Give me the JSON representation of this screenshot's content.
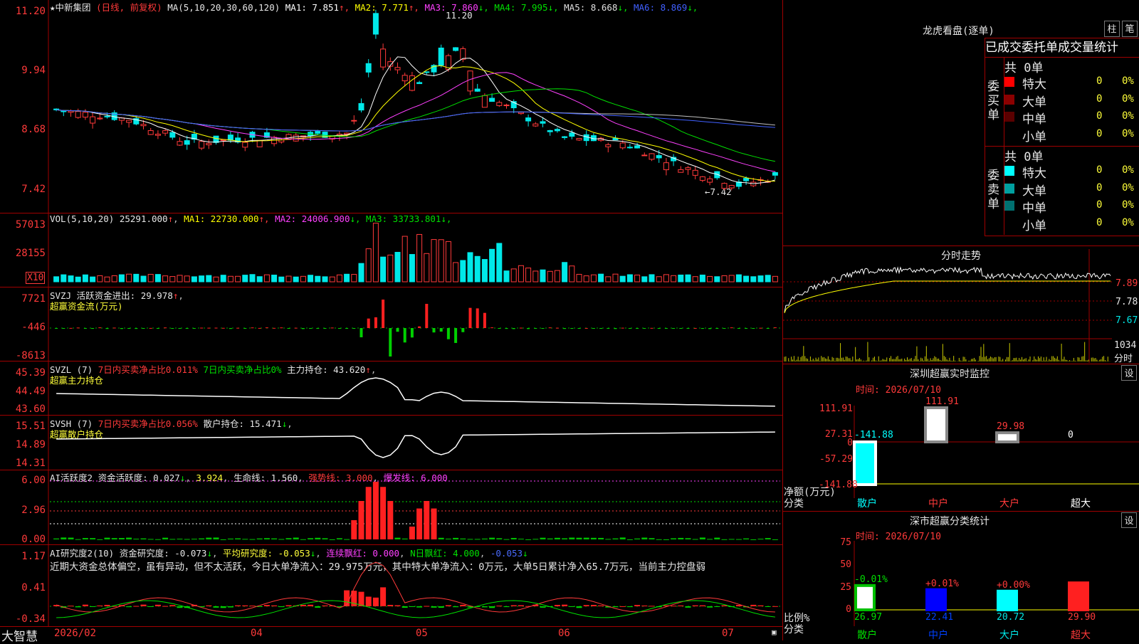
{
  "stock": {
    "name": "★中新集团",
    "mode": "(日线, 前复权)",
    "ma_header": "MA(5,10,20,30,60,120)",
    "ma": [
      {
        "label": "MA1: 7.851",
        "arrow": "↑",
        "color": "#ffffff"
      },
      {
        "label": "MA2: 7.771",
        "arrow": "↑",
        "color": "#ffff00"
      },
      {
        "label": "MA3: 7.860",
        "arrow": "↓",
        "color": "#ff40ff"
      },
      {
        "label": "MA4: 7.995",
        "arrow": "↓",
        "color": "#00e000"
      },
      {
        "label": "MA5: 8.668",
        "arrow": "↓",
        "color": "#e0e0e0"
      },
      {
        "label": "MA6: 8.869",
        "arrow": "↓",
        "color": "#4060ff"
      }
    ],
    "high_mark": "11.20",
    "low_mark": "←7.42",
    "price_axis": [
      "11.20",
      "9.94",
      "8.68",
      "7.42"
    ]
  },
  "volume": {
    "header": "VOL(5,10,20)",
    "value": "25291.000",
    "ma": [
      {
        "label": "MA1: 22730.000",
        "arrow": "↑",
        "color": "#ffff00"
      },
      {
        "label": "MA2: 24006.900",
        "arrow": "↓",
        "color": "#ff40ff"
      },
      {
        "label": "MA3: 33733.801",
        "arrow": "↓",
        "color": "#00e000"
      }
    ],
    "axis": [
      "57013",
      "28155"
    ],
    "unit": "X10"
  },
  "svzj": {
    "header": "SVZJ",
    "label": "活跃资金进出: 29.978",
    "arrow": "↑",
    "title": "超赢资金流(万元)",
    "axis": [
      "7721",
      "-446",
      "-8613"
    ]
  },
  "svzl": {
    "header": "SVZL (7)",
    "t1": "7日内买卖净占比0.011%",
    "t2": "7日内买卖净占比0%",
    "t3": "主力持仓: 43.620",
    "arrow": "↑",
    "title": "超赢主力持仓",
    "axis": [
      "45.39",
      "44.49",
      "43.60"
    ]
  },
  "svsh": {
    "header": "SVSH (7)",
    "t1": "7日内买卖净占比0.056%",
    "t2": "散户持仓: 15.471",
    "arrow": "↓",
    "title": "超赢散户持仓",
    "axis": [
      "15.51",
      "14.89",
      "14.31"
    ]
  },
  "ai_active": {
    "header": "AI活跃度2",
    "t1": "资金活跃度: 0.027",
    "a1": "↓",
    "t2": "3.924",
    "t3": "生命线: 1.560",
    "t4": "强势线: 3.000",
    "t5": "爆发线: 6.000",
    "axis": [
      "6.00",
      "2.96",
      "0.00"
    ]
  },
  "ai_research": {
    "header": "AI研究度2(10)",
    "t1": "资金研究度: -0.073",
    "a1": "↓",
    "t2": "平均研究度: -0.053",
    "a2": "↓",
    "t3": "连续飘红: 0.000",
    "t4": "N日飘红: 4.000",
    "t5": "-0.053",
    "a5": "↓",
    "summary": "近期大资金总体偏空，虽有异动，但不太活跃，今日大单净流入：29.975万元，其中特大单净流入：0万元，大单5日累计净入65.7万元，当前主力控盘弱",
    "axis": [
      "1.17",
      "0.41",
      "-0.34"
    ]
  },
  "footer": {
    "brand": "大智慧",
    "dates": [
      "2026/02",
      "04",
      "05",
      "06",
      "07"
    ]
  },
  "lhb": {
    "title": "龙虎看盘(逐单)",
    "btn_bar": "柱",
    "btn_pen": "笔",
    "tabs": [
      "已成交",
      "委托单",
      "成交量统计"
    ],
    "buy_label": "委买单",
    "sell_label": "委卖单",
    "buy_total": "共 0单",
    "sell_total": "共 0单",
    "buy_rows": [
      {
        "name": "特大",
        "count": "0",
        "pct": "0%",
        "color": "#ff0000"
      },
      {
        "name": "大单",
        "count": "0",
        "pct": "0%",
        "color": "#8b0000"
      },
      {
        "name": "中单",
        "count": "0",
        "pct": "0%",
        "color": "#5a0000"
      },
      {
        "name": "小单",
        "count": "0",
        "pct": "0%",
        "color": ""
      }
    ],
    "sell_rows": [
      {
        "name": "特大",
        "count": "0",
        "pct": "0%",
        "color": "#00ffff"
      },
      {
        "name": "大单",
        "count": "0",
        "pct": "0%",
        "color": "#00a0a0"
      },
      {
        "name": "中单",
        "count": "0",
        "pct": "0%",
        "color": "#007070"
      },
      {
        "name": "小单",
        "count": "0",
        "pct": "0%",
        "color": ""
      }
    ]
  },
  "intraday": {
    "title": "分时走势",
    "axis": [
      "7.89",
      "7.78",
      "7.67"
    ],
    "vol_axis": [
      "1034",
      "分时"
    ]
  },
  "sz_monitor": {
    "title": "深圳超赢实时监控",
    "set": "设",
    "time": "时间: 2026/07/10",
    "axis": [
      "111.91",
      "27.31",
      "0",
      "-57.29",
      "-141.88"
    ],
    "ylabel1": "净额(万元)",
    "ylabel2": "分类",
    "bars": [
      {
        "cat": "散户",
        "value": -141.88,
        "label": "-141.88"
      },
      {
        "cat": "中户",
        "value": 111.91,
        "label": "111.91"
      },
      {
        "cat": "大户",
        "value": 29.98,
        "label": "29.98"
      },
      {
        "cat": "超大",
        "value": 0,
        "label": "0"
      }
    ]
  },
  "sz_class": {
    "title": "深市超赢分类统计",
    "set": "设",
    "time": "时间: 2026/07/10",
    "axis": [
      "75",
      "50",
      "25",
      "0"
    ],
    "ylabel1": "比例%",
    "ylabel2": "分类",
    "bars": [
      {
        "cat": "散户",
        "value": 26.97,
        "label": "26.97",
        "change": "-0.01%"
      },
      {
        "cat": "中户",
        "value": 22.41,
        "label": "22.41",
        "change": "+0.01%"
      },
      {
        "cat": "大户",
        "value": 20.72,
        "label": "20.72",
        "change": "+0.00%"
      },
      {
        "cat": "超大",
        "value": 29.9,
        "label": "29.90",
        "change": ""
      }
    ]
  }
}
